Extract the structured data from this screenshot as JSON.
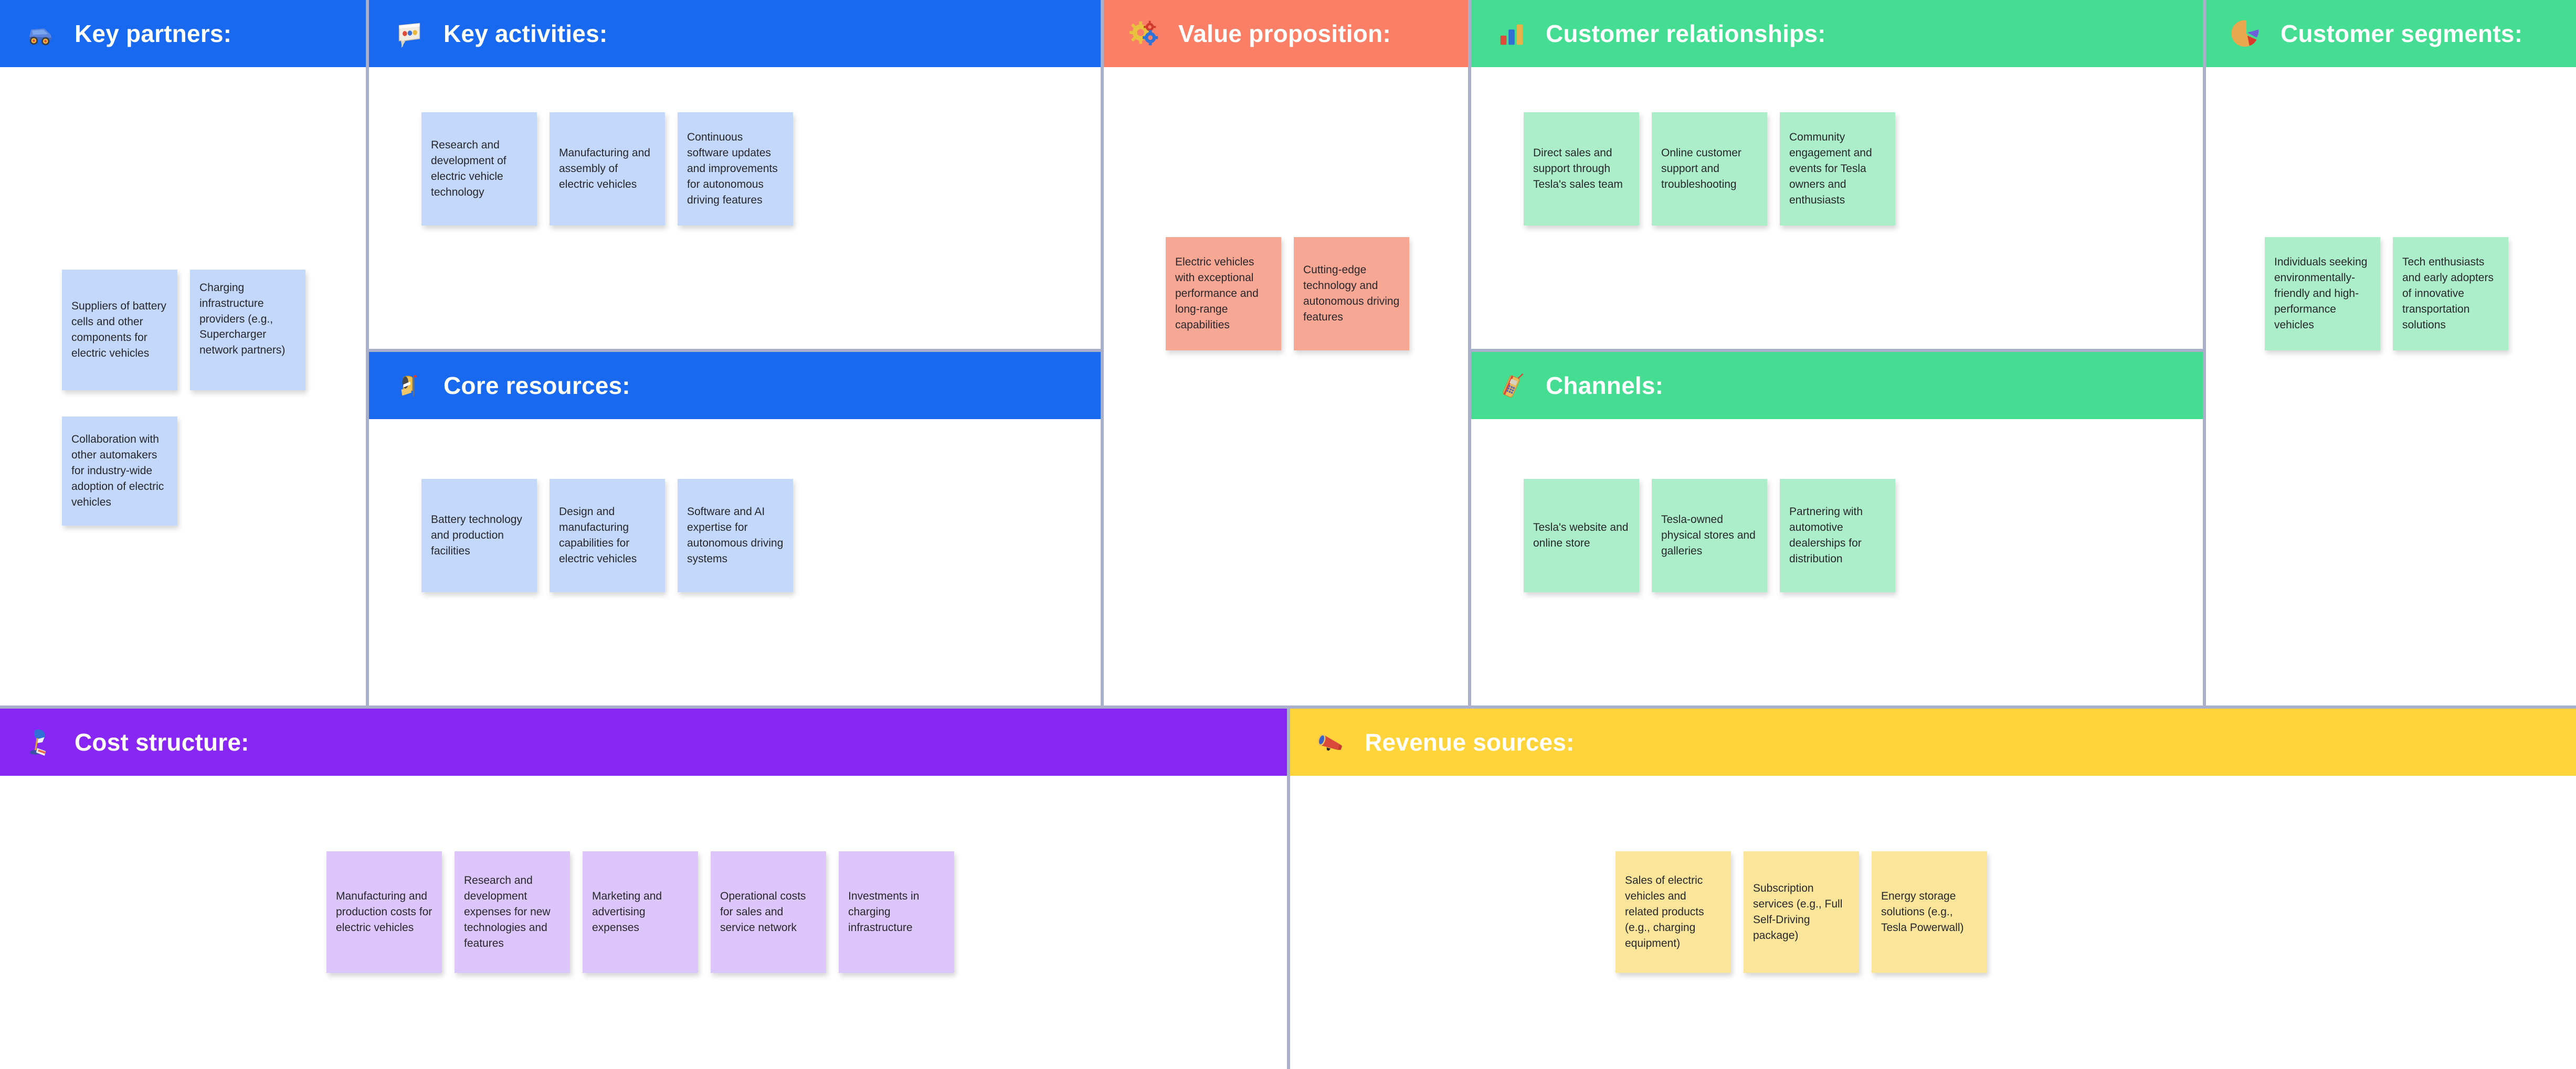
{
  "canvas": {
    "type": "business-model-canvas",
    "subject": "Tesla"
  },
  "colors": {
    "header_blue": "#1969f0",
    "header_salmon": "#fb7f67",
    "header_green": "#44dd92",
    "header_purple": "#8827f5",
    "header_yellow": "#ffd43b",
    "note_blue": "#c4d8fb",
    "note_salmon": "#f9a795",
    "note_green": "#abeec9",
    "note_purple": "#ddc6fb",
    "note_yellow": "#fbe59a",
    "border": "#aab0cc"
  },
  "sections": {
    "key_partners": {
      "title": "Key partners:",
      "icon": "car-icon",
      "header_color": "#1969f0",
      "note_color": "#c4d8fb",
      "notes": [
        "Suppliers of battery cells and other components for electric vehicles",
        "Charging infrastructure providers (e.g., Supercharger network partners)",
        "Collaboration with other automakers for industry-wide adoption of electric vehicles"
      ]
    },
    "key_activities": {
      "title": "Key activities:",
      "icon": "speech-balloon-icon",
      "header_color": "#1969f0",
      "note_color": "#c4d8fb",
      "notes": [
        "Research and development of electric vehicle technology",
        "Manufacturing and assembly of electric vehicles",
        "Continuous software updates and improvements for autonomous driving features"
      ]
    },
    "core_resources": {
      "title": "Core resources:",
      "icon": "mailbox-icon",
      "header_color": "#1969f0",
      "note_color": "#c4d8fb",
      "notes": [
        "Battery technology and production facilities",
        "Design and manufacturing capabilities for electric vehicles",
        "Software and AI expertise for autonomous driving systems"
      ]
    },
    "value_proposition": {
      "title": "Value proposition:",
      "icon": "gears-icon",
      "header_color": "#fb7f67",
      "note_color": "#f9a795",
      "notes": [
        "Electric vehicles with exceptional performance and long-range capabilities",
        "Cutting-edge technology and autonomous driving features"
      ]
    },
    "customer_relationships": {
      "title": "Customer relationships:",
      "icon": "bar-chart-icon",
      "header_color": "#44dd92",
      "note_color": "#abeec9",
      "notes": [
        "Direct sales and support through Tesla's sales team",
        "Online customer support and troubleshooting",
        "Community engagement and events for Tesla owners and enthusiasts"
      ]
    },
    "channels": {
      "title": "Channels:",
      "icon": "mobile-phone-icon",
      "header_color": "#44dd92",
      "note_color": "#abeec9",
      "notes": [
        "Tesla's website and online store",
        "Tesla-owned physical stores and galleries",
        "Partnering with automotive dealerships for distribution"
      ]
    },
    "customer_segments": {
      "title": "Customer segments:",
      "icon": "pie-chart-icon",
      "header_color": "#44dd92",
      "note_color": "#abeec9",
      "notes": [
        "Individuals seeking environmentally-friendly and high-performance vehicles",
        "Tech enthusiasts and early adopters of innovative transportation solutions"
      ]
    },
    "cost_structure": {
      "title": "Cost structure:",
      "icon": "desk-lamp-icon",
      "header_color": "#8827f5",
      "note_color": "#ddc6fb",
      "notes": [
        "Manufacturing and production costs for electric vehicles",
        "Research and development expenses for new technologies and features",
        "Marketing and advertising expenses",
        "Operational costs for sales and service network",
        "Investments in charging infrastructure"
      ]
    },
    "revenue_sources": {
      "title": "Revenue sources:",
      "icon": "megaphone-icon",
      "header_color": "#ffd43b",
      "note_color": "#fbe59a",
      "notes": [
        "Sales of electric vehicles and related products (e.g., charging equipment)",
        "Subscription services (e.g., Full Self-Driving package)",
        "Energy storage solutions (e.g., Tesla Powerwall)"
      ]
    }
  }
}
